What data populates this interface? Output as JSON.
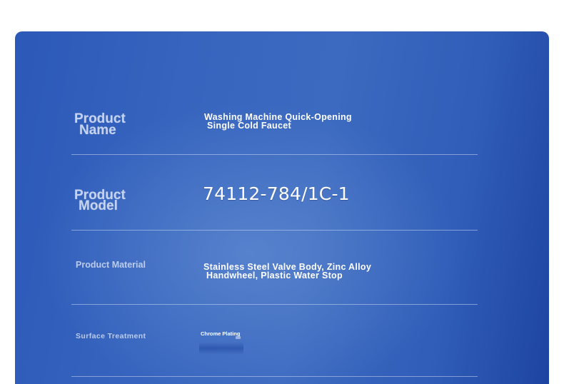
{
  "spec_table": {
    "rows": [
      {
        "label_line1": "Product",
        "label_line2": "Name",
        "value_line1": "Washing Machine Quick-Opening",
        "value_line2": "Single Cold Faucet"
      },
      {
        "label_line1": "Product",
        "label_line2": "Model",
        "value": "74112-784/1C-1"
      },
      {
        "label": "Product Material",
        "value_line1": "Stainless Steel Valve Body, Zinc Alloy",
        "value_line2": "Handwheel, Plastic Water Stop"
      },
      {
        "label": "Surface Treatment",
        "value": "Chrome Plating"
      }
    ]
  },
  "colors": {
    "card_background": "#3866bf",
    "card_edge": "#1d43a0",
    "text_value": "#ffffff",
    "text_label": "#d7e1f5",
    "divider": "#c8d7f0"
  }
}
